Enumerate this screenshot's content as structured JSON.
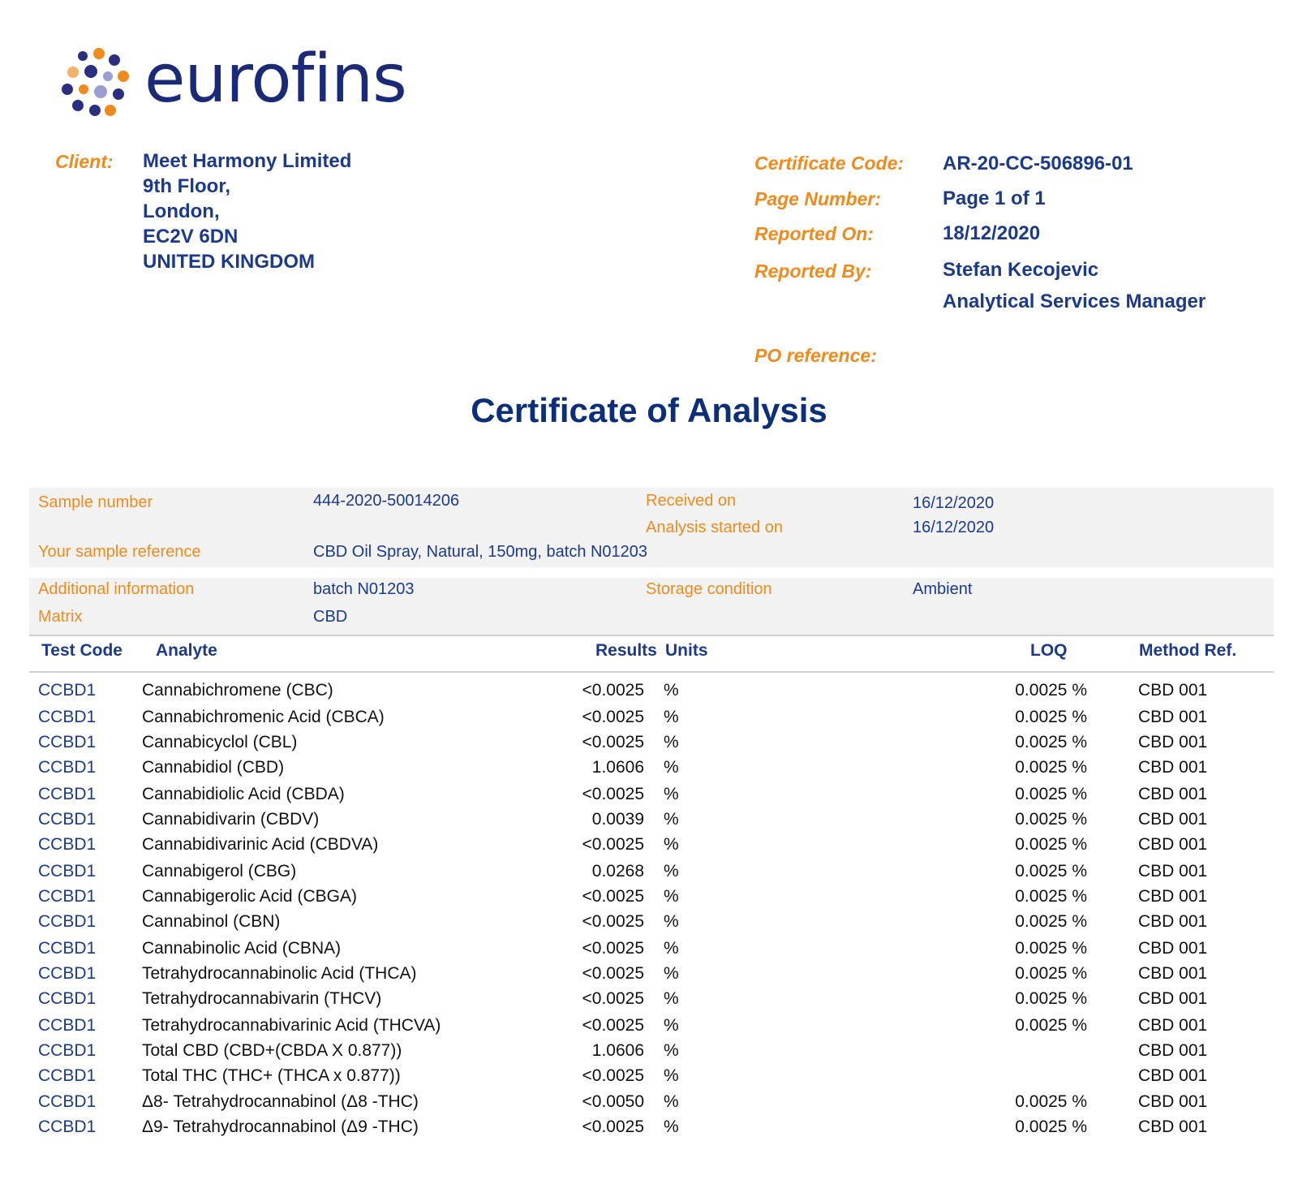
{
  "logo": {
    "text": "eurofins"
  },
  "client": {
    "label": "Client:",
    "lines": [
      "Meet Harmony Limited",
      "9th Floor,",
      "London,",
      "EC2V 6DN",
      "UNITED KINGDOM"
    ]
  },
  "certificate": {
    "code_label": "Certificate Code:",
    "code": "AR-20-CC-506896-01",
    "page_label": "Page Number:",
    "page": "Page 1 of 1",
    "reported_on_label": "Reported On:",
    "reported_on": "18/12/2020",
    "reported_by_label": "Reported By:",
    "reported_by": "Stefan Kecojevic",
    "reported_by_title": "Analytical Services Manager",
    "po_label": "PO reference:"
  },
  "title": "Certificate of Analysis",
  "sample": {
    "sample_number_label": "Sample number",
    "sample_number": "444-2020-50014206",
    "received_label": "Received on",
    "received": "16/12/2020",
    "analysis_started_label": "Analysis started on",
    "analysis_started": "16/12/2020",
    "reference_label": "Your sample reference",
    "reference": "CBD Oil Spray, Natural, 150mg, batch N01203",
    "additional_label": "Additional information",
    "additional": "batch N01203",
    "storage_label": "Storage condition",
    "storage": "Ambient",
    "matrix_label": "Matrix",
    "matrix": "CBD"
  },
  "table": {
    "headers": [
      "Test Code",
      "Analyte",
      "Results",
      "Units",
      "LOQ",
      "Method Ref."
    ],
    "rows": [
      [
        "CCBD1",
        "Cannabichromene (CBC)",
        "<0.0025",
        "%",
        "0.0025 %",
        "CBD 001"
      ],
      [
        "CCBD1",
        "Cannabichromenic Acid (CBCA)",
        "<0.0025",
        "%",
        "0.0025 %",
        "CBD 001"
      ],
      [
        "CCBD1",
        "Cannabicyclol (CBL)",
        "<0.0025",
        "%",
        "0.0025 %",
        "CBD 001"
      ],
      [
        "CCBD1",
        "Cannabidiol (CBD)",
        "1.0606",
        "%",
        "0.0025 %",
        "CBD 001"
      ],
      [
        "CCBD1",
        "Cannabidiolic Acid (CBDA)",
        "<0.0025",
        "%",
        "0.0025 %",
        "CBD 001"
      ],
      [
        "CCBD1",
        "Cannabidivarin (CBDV)",
        "0.0039",
        "%",
        "0.0025 %",
        "CBD 001"
      ],
      [
        "CCBD1",
        "Cannabidivarinic Acid (CBDVA)",
        "<0.0025",
        "%",
        "0.0025 %",
        "CBD 001"
      ],
      [
        "CCBD1",
        "Cannabigerol (CBG)",
        "0.0268",
        "%",
        "0.0025 %",
        "CBD 001"
      ],
      [
        "CCBD1",
        "Cannabigerolic Acid (CBGA)",
        "<0.0025",
        "%",
        "0.0025 %",
        "CBD 001"
      ],
      [
        "CCBD1",
        "Cannabinol (CBN)",
        "<0.0025",
        "%",
        "0.0025 %",
        "CBD 001"
      ],
      [
        "CCBD1",
        "Cannabinolic Acid (CBNA)",
        "<0.0025",
        "%",
        "0.0025 %",
        "CBD 001"
      ],
      [
        "CCBD1",
        "Tetrahydrocannabinolic Acid (THCA)",
        "<0.0025",
        "%",
        "0.0025 %",
        "CBD 001"
      ],
      [
        "CCBD1",
        "Tetrahydrocannabivarin (THCV)",
        "<0.0025",
        "%",
        "0.0025 %",
        "CBD 001"
      ],
      [
        "CCBD1",
        "Tetrahydrocannabivarinic Acid (THCVA)",
        "<0.0025",
        "%",
        "0.0025 %",
        "CBD 001"
      ],
      [
        "CCBD1",
        "Total CBD (CBD+(CBDA X 0.877))",
        "1.0606",
        "%",
        "",
        "CBD 001"
      ],
      [
        "CCBD1",
        "Total THC (THC+ (THCA x 0.877))",
        "<0.0025",
        "%",
        "",
        "CBD 001"
      ],
      [
        "CCBD1",
        "Δ8- Tetrahydrocannabinol (Δ8 -THC)",
        "<0.0050",
        "%",
        "0.0025 %",
        "CBD 001"
      ],
      [
        "CCBD1",
        "Δ9- Tetrahydrocannabinol (Δ9 -THC)",
        "<0.0025",
        "%",
        "0.0025 %",
        "CBD 001"
      ]
    ]
  },
  "colors": {
    "orange": "#f08a1c",
    "navy": "#1b3a8c",
    "dark_navy": "#0d2f7a",
    "band": "#f2f2f2"
  }
}
